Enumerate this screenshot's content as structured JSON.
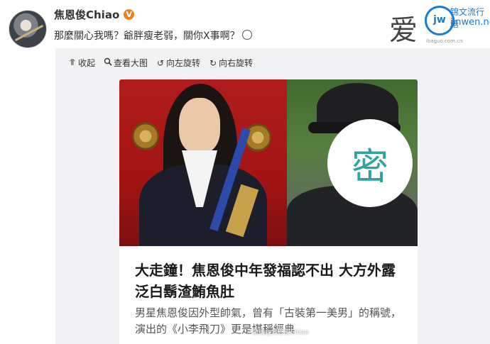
{
  "post": {
    "username": "焦恩俊Chiao",
    "verified_badge": "V",
    "text": "那麼關心我嗎？爺胖瘦老弱，關你X事啊？",
    "emoji": "smile-emoji"
  },
  "watermark": {
    "char": "爱",
    "circle_text": "jw",
    "brand": "锦文流行语",
    "url": "jinwen.net",
    "small": "ibaguo.com.cn"
  },
  "toolbar": {
    "items": [
      {
        "icon": "collapse-icon",
        "label": "收起"
      },
      {
        "icon": "magnify-icon",
        "label": "查看大图"
      },
      {
        "icon": "rotate-left-icon",
        "label": "向左旋转"
      },
      {
        "icon": "rotate-right-icon",
        "label": "向右旋转"
      }
    ]
  },
  "article": {
    "mosaic_char": "密",
    "headline": "大走鐘！焦恩俊中年發福認不出 大方外露泛白鬍渣鮪魚肚",
    "summary": "男星焦恩俊因外型帥氣，曾有「古裝第一美男」的稱號，演出的《小李飛刀》更是堪稱經典",
    "source_mark": "微博@焦恩俊Chiao"
  },
  "colors": {
    "badge": "#f0811b",
    "brand_blue": "#1a7bd0",
    "card_bg": "#f2f2f5"
  }
}
